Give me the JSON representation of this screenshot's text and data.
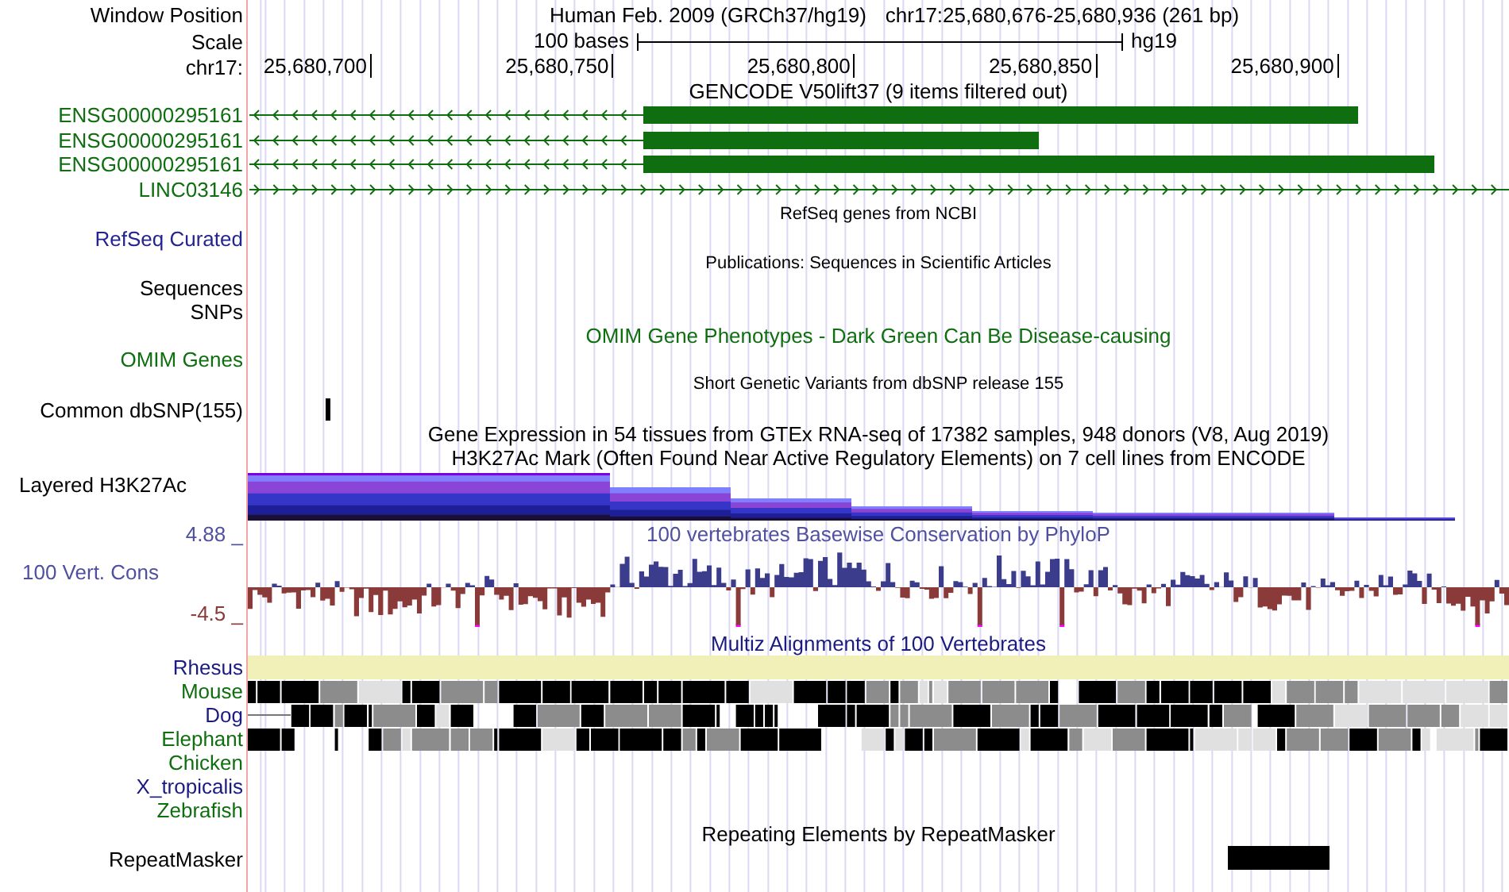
{
  "window_position": {
    "label": "Window Position",
    "assembly": "Human Feb. 2009 (GRCh37/hg19)",
    "position": "chr17:25,680,676-25,680,936 (261 bp)"
  },
  "scale": {
    "label": "Scale",
    "length": "100 bases",
    "genome": "hg19"
  },
  "ruler": {
    "label": "chr17:",
    "ticks": [
      "25,680,700",
      "25,680,750",
      "25,680,800",
      "25,680,850",
      "25,680,900"
    ]
  },
  "tracks": [
    {
      "kind": "heading",
      "text": "GENCODE V50lift37 (9 items filtered out)",
      "color": "#000000"
    },
    {
      "kind": "gene",
      "label": "ENSG00000295161",
      "color": "#0f6e0f",
      "reverse_strand": true
    },
    {
      "kind": "gene",
      "label": "ENSG00000295161",
      "color": "#0f6e0f",
      "reverse_strand": true
    },
    {
      "kind": "gene",
      "label": "ENSG00000295161",
      "color": "#0f6e0f",
      "reverse_strand": true
    },
    {
      "kind": "gene",
      "label": "LINC03146",
      "color": "#0f6e0f",
      "reverse_strand": false
    },
    {
      "kind": "note",
      "text": "RefSeq genes from NCBI"
    },
    {
      "kind": "label",
      "label": "RefSeq Curated",
      "color": "#24248f"
    },
    {
      "kind": "note",
      "text": "Publications: Sequences in Scientific Articles"
    },
    {
      "kind": "label",
      "label": "Sequences",
      "color": "#000000"
    },
    {
      "kind": "label",
      "label": "SNPs",
      "color": "#000000"
    },
    {
      "kind": "heading",
      "text": "OMIM Gene Phenotypes - Dark Green Can Be Disease-causing",
      "color": "#0f6e0f"
    },
    {
      "kind": "label",
      "label": "OMIM Genes",
      "color": "#0f6e0f"
    },
    {
      "kind": "note",
      "text": "Short Genetic Variants from dbSNP release 155"
    },
    {
      "kind": "snp",
      "label": "Common dbSNP(155)",
      "color": "#000000"
    },
    {
      "kind": "heading",
      "text": "Gene Expression in 54 tissues from GTEx RNA-seq of 17382 samples, 948 donors (V8, Aug 2019)",
      "color": "#000000"
    },
    {
      "kind": "heading",
      "text": "H3K27Ac Mark (Often Found Near Active Regulatory Elements) on 7 cell lines from ENCODE",
      "color": "#000000"
    },
    {
      "kind": "layered",
      "label": "Layered H3K27Ac",
      "color": "#000000"
    },
    {
      "kind": "wiggle",
      "title": "100 vertebrates Basewise Conservation by PhyloP",
      "label": "100 Vert. Cons",
      "color": "#5050a0",
      "max_label": "4.88 _",
      "min_label": "-4.5 _"
    },
    {
      "kind": "heading",
      "text": "Multiz Alignments of 100 Vertebrates",
      "color": "#1a1a80"
    },
    {
      "kind": "shaded",
      "label": "Rhesus",
      "color": "#1a1a80"
    },
    {
      "kind": "blocks",
      "label": "Mouse",
      "color": "#0f6e0f"
    },
    {
      "kind": "blocks",
      "label": "Dog",
      "color": "#1a1a80"
    },
    {
      "kind": "blocks",
      "label": "Elephant",
      "color": "#0f6e0f"
    },
    {
      "kind": "species",
      "label": "Chicken",
      "color": "#0f6e0f"
    },
    {
      "kind": "species",
      "label": "X_tropicalis",
      "color": "#1a1a80"
    },
    {
      "kind": "species",
      "label": "Zebrafish",
      "color": "#0f6e0f"
    },
    {
      "kind": "heading",
      "text": "Repeating Elements by RepeatMasker",
      "color": "#000000"
    },
    {
      "kind": "repeat",
      "label": "RepeatMasker",
      "color": "#000000"
    }
  ]
}
